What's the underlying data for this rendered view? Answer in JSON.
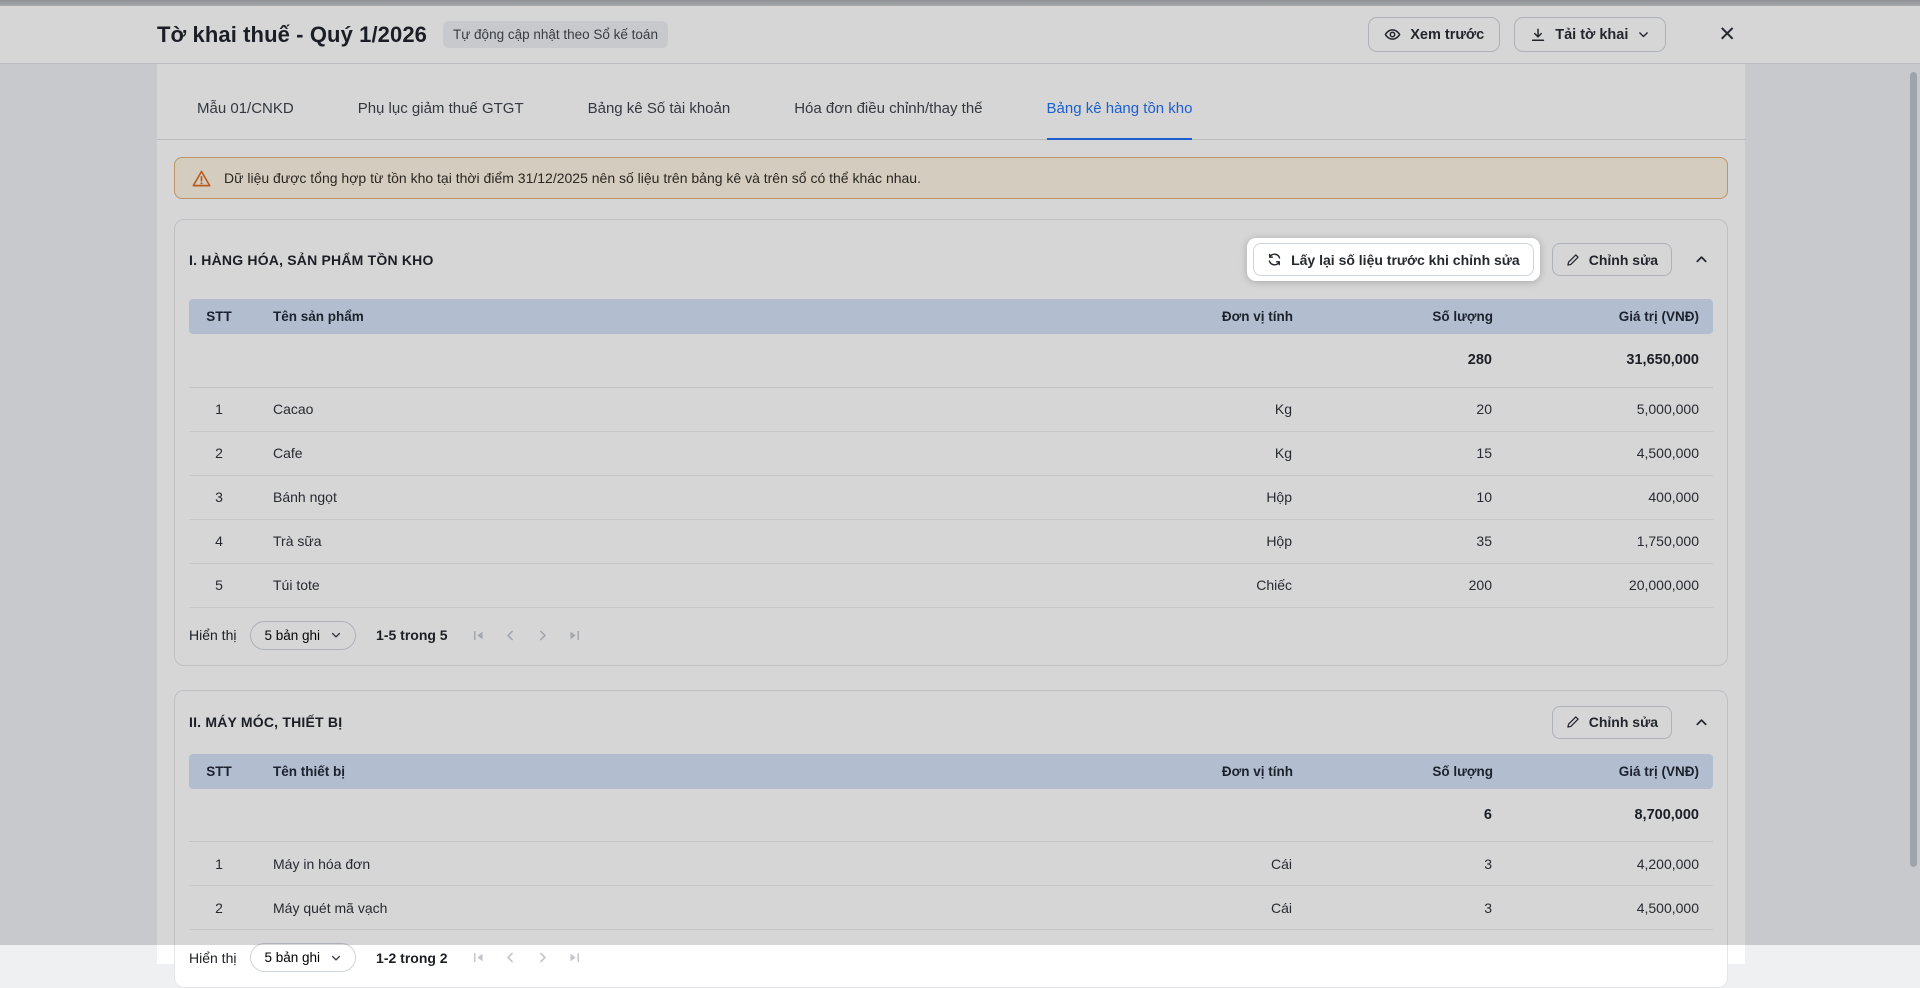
{
  "header": {
    "title": "Tờ khai thuế - Quý 1/2026",
    "badge": "Tự động cập nhật theo Sổ kế toán",
    "preview_label": "Xem trước",
    "download_label": "Tải tờ khai",
    "close_glyph": "✕"
  },
  "tabs": [
    {
      "label": "Mẫu 01/CNKD"
    },
    {
      "label": "Phụ lục giảm thuế GTGT"
    },
    {
      "label": "Bảng kê Số tài khoản"
    },
    {
      "label": "Hóa đơn điều chỉnh/thay thế"
    },
    {
      "label": "Bảng kê hàng tồn kho"
    }
  ],
  "active_tab": "Bảng kê hàng tồn kho",
  "warning": "Dữ liệu được tổng hợp từ tồn kho tại thời điểm 31/12/2025 nên số liệu trên bảng kê và trên sổ có thể khác nhau.",
  "sections": [
    {
      "title": "I. HÀNG HÓA, SẢN PHẨM TỒN KHO",
      "restore_label": "Lấy lại số liệu trước khi chỉnh sửa",
      "edit_label": "Chỉnh sửa",
      "columns": [
        "STT",
        "Tên sản phẩm",
        "Đơn vị tính",
        "Số lượng",
        "Giá trị (VNĐ)"
      ],
      "total": {
        "quantity": "280",
        "value": "31,650,000"
      },
      "rows": [
        {
          "stt": "1",
          "name": "Cacao",
          "unit": "Kg",
          "quantity": "20",
          "value": "5,000,000"
        },
        {
          "stt": "2",
          "name": "Cafe",
          "unit": "Kg",
          "quantity": "15",
          "value": "4,500,000"
        },
        {
          "stt": "3",
          "name": "Bánh ngọt",
          "unit": "Hộp",
          "quantity": "10",
          "value": "400,000"
        },
        {
          "stt": "4",
          "name": "Trà sữa",
          "unit": "Hộp",
          "quantity": "35",
          "value": "1,750,000"
        },
        {
          "stt": "5",
          "name": "Túi tote",
          "unit": "Chiếc",
          "quantity": "200",
          "value": "20,000,000"
        }
      ],
      "pagination": {
        "label": "Hiển thị",
        "page_size": "5 bản ghi",
        "range": "1-5 trong 5"
      }
    },
    {
      "title": "II. MÁY MÓC, THIẾT BỊ",
      "edit_label": "Chỉnh sửa",
      "columns": [
        "STT",
        "Tên thiết bị",
        "Đơn vị tính",
        "Số lượng",
        "Giá trị (VNĐ)"
      ],
      "total": {
        "quantity": "6",
        "value": "8,700,000"
      },
      "rows": [
        {
          "stt": "1",
          "name": "Máy in hóa đơn",
          "unit": "Cái",
          "quantity": "3",
          "value": "4,200,000"
        },
        {
          "stt": "2",
          "name": "Máy quét mã vạch",
          "unit": "Cái",
          "quantity": "3",
          "value": "4,500,000"
        }
      ],
      "pagination": {
        "label": "Hiển thị",
        "page_size": "5 bản ghi",
        "range": "1-2 trong 2"
      }
    }
  ],
  "colors": {
    "accent": "#1e6ef5",
    "table_header_bg": "#d3e2f6",
    "warning_bg": "#fdf3e2",
    "warning_border": "#e0b077",
    "warning_icon": "#dd6b20"
  }
}
